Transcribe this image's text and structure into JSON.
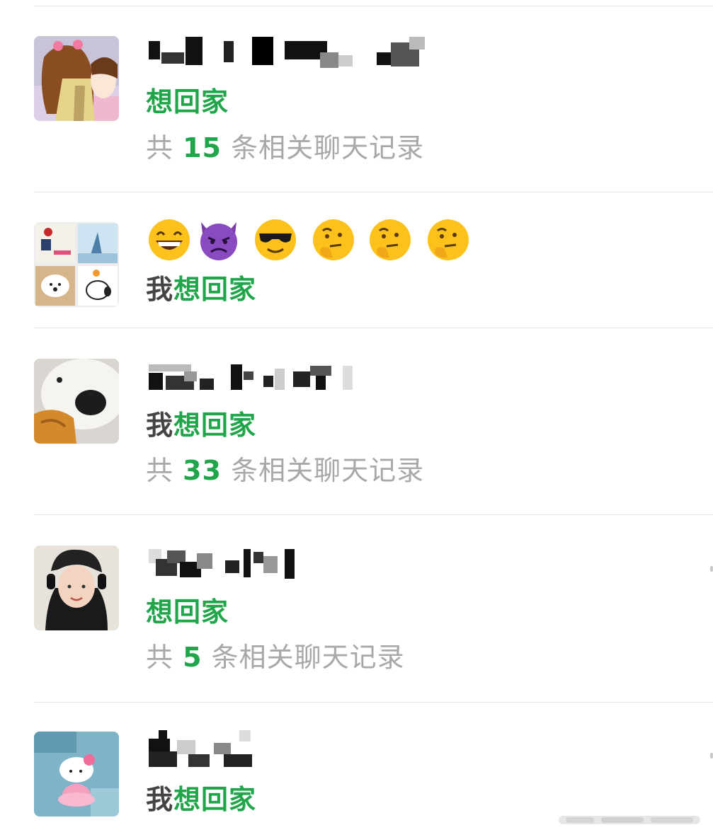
{
  "results": [
    {
      "id": "result-1",
      "avatar_icon": "cartoon-girl-avatar-icon",
      "match_prefix": "",
      "match_keyword": "想回家",
      "count_prefix": "共",
      "count_value": "15",
      "count_suffix": "条相关聊天记录"
    },
    {
      "id": "result-2",
      "avatar_icon": "group-collage-avatar-icon",
      "emoji_name": [
        "grinning-face-icon",
        "angry-devil-icon",
        "sunglasses-face-icon",
        "thinking-face-icon",
        "thinking-face-icon",
        "thinking-face-icon"
      ],
      "match_prefix": "我",
      "match_keyword": "想回家"
    },
    {
      "id": "result-3",
      "avatar_icon": "white-dog-avatar-icon",
      "match_prefix": "我",
      "match_keyword": "想回家",
      "count_prefix": "共",
      "count_value": "33",
      "count_suffix": "条相关聊天记录"
    },
    {
      "id": "result-4",
      "avatar_icon": "girl-headphones-avatar-icon",
      "match_prefix": "",
      "match_keyword": "想回家",
      "count_prefix": "共",
      "count_value": "5",
      "count_suffix": "条相关聊天记录"
    },
    {
      "id": "result-5",
      "avatar_icon": "hello-kitty-avatar-icon",
      "match_prefix": "我",
      "match_keyword": "想回家"
    }
  ],
  "colors": {
    "keyword_green": "#21a54a",
    "muted_gray": "#a8a8a8",
    "divider": "#e4e4e4"
  }
}
